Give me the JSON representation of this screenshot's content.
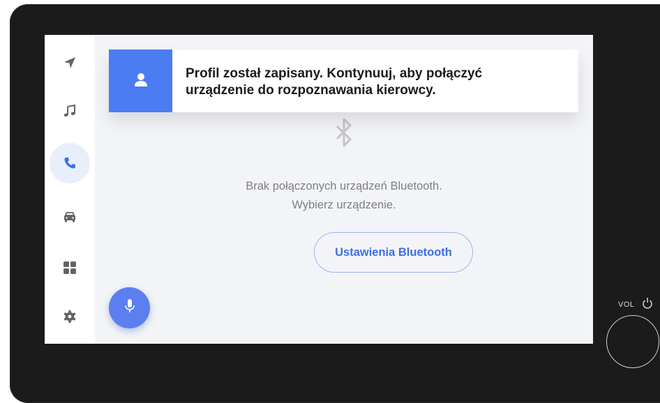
{
  "notification": {
    "icon": "user-icon",
    "message": "Profil został zapisany. Kontynuuj, aby połączyć urządzenie do rozpoznawania kierowcy."
  },
  "sidebar": {
    "items": [
      {
        "id": "navigation",
        "icon": "navigation-arrow-icon",
        "active": false
      },
      {
        "id": "music",
        "icon": "music-note-icon",
        "active": false
      },
      {
        "id": "phone",
        "icon": "phone-icon",
        "active": true
      },
      {
        "id": "car",
        "icon": "car-icon",
        "active": false
      },
      {
        "id": "apps",
        "icon": "apps-grid-icon",
        "active": false
      },
      {
        "id": "settings",
        "icon": "gear-icon",
        "active": false
      }
    ]
  },
  "bluetooth": {
    "icon": "bluetooth-icon",
    "empty_line1": "Brak połączonych urządzeń Bluetooth.",
    "empty_line2": "Wybierz urządzenie.",
    "settings_button": "Ustawienia Bluetooth"
  },
  "voice": {
    "icon": "microphone-icon"
  },
  "hardware": {
    "volume_label": "VOL"
  },
  "colors": {
    "accent": "#4c7cf1",
    "screen_bg": "#f3f4f7",
    "bezel": "#1b1b1b",
    "active_item_bg": "#e9eefb"
  }
}
